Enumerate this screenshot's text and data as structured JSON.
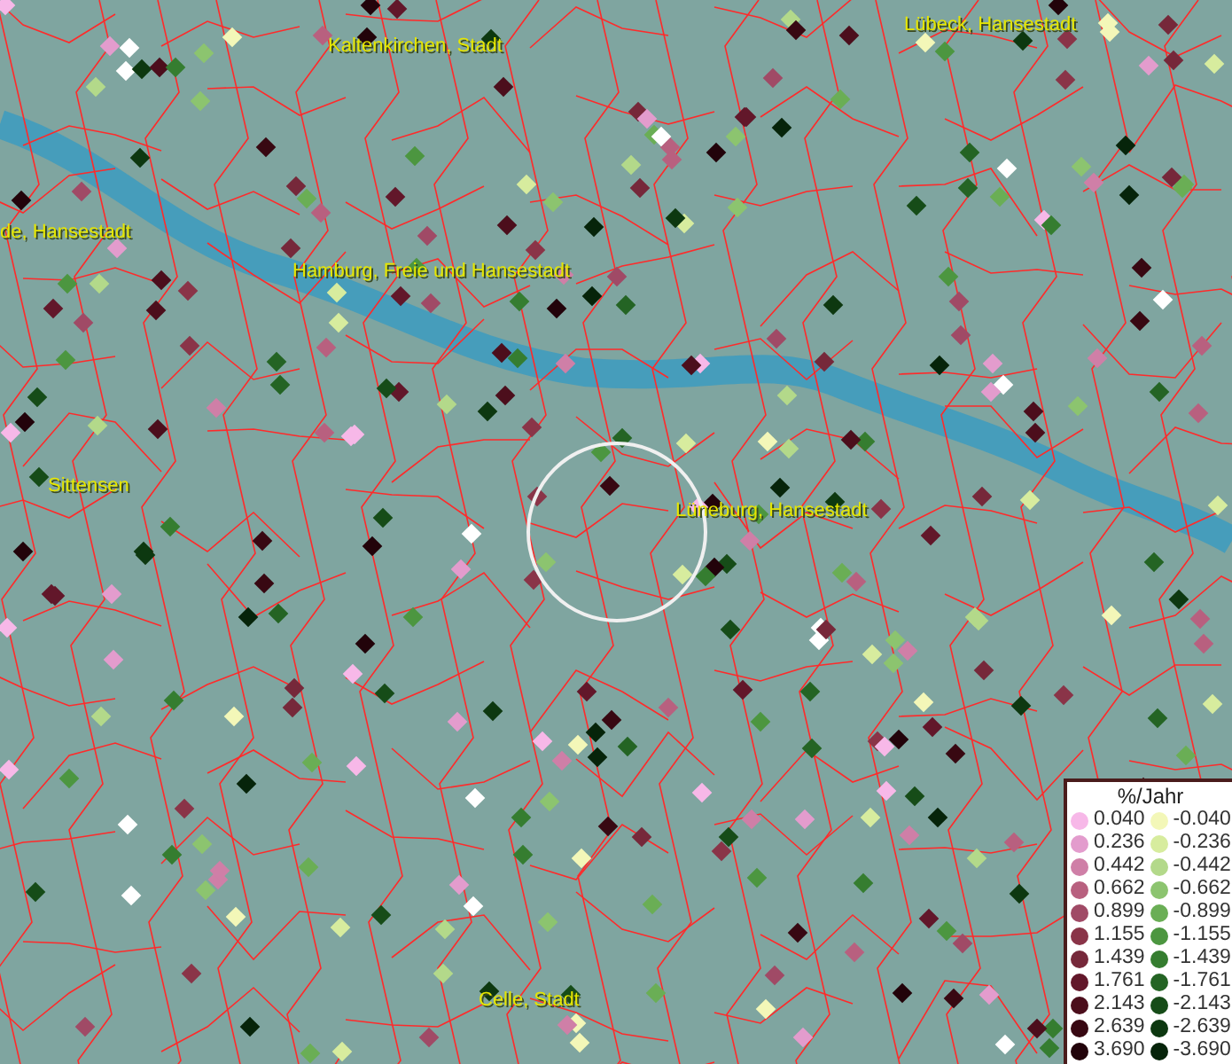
{
  "map": {
    "places": [
      {
        "name": "Kaltenkirchen, Stadt"
      },
      {
        "name": "Lübeck, Hansestadt"
      },
      {
        "name": "de, Hansestadt"
      },
      {
        "name": "Hamburg, Freie und Hansestadt"
      },
      {
        "name": "Sittensen"
      },
      {
        "name": "Lüneburg, Hansestadt"
      },
      {
        "name": "Celle, Stadt"
      }
    ]
  },
  "legend": {
    "title": "%/Jahr",
    "rows": [
      {
        "positive": {
          "value": "0.040",
          "color": "#f7b8e8"
        },
        "negative": {
          "value": "-0.040",
          "color": "#f3f7b8"
        }
      },
      {
        "positive": {
          "value": "0.236",
          "color": "#e39ccd"
        },
        "negative": {
          "value": "-0.236",
          "color": "#d7ec9e"
        }
      },
      {
        "positive": {
          "value": "0.442",
          "color": "#cf7fa7"
        },
        "negative": {
          "value": "-0.442",
          "color": "#b3d98a"
        }
      },
      {
        "positive": {
          "value": "0.662",
          "color": "#b8607f"
        },
        "negative": {
          "value": "-0.662",
          "color": "#8cc46f"
        }
      },
      {
        "positive": {
          "value": "0.899",
          "color": "#a04a66"
        },
        "negative": {
          "value": "-0.899",
          "color": "#6aae55"
        }
      },
      {
        "positive": {
          "value": "1.155",
          "color": "#8a3448"
        },
        "negative": {
          "value": "-1.155",
          "color": "#4c9640"
        }
      },
      {
        "positive": {
          "value": "1.439",
          "color": "#76283a"
        },
        "negative": {
          "value": "-1.439",
          "color": "#357d30"
        }
      },
      {
        "positive": {
          "value": "1.761",
          "color": "#62172a"
        },
        "negative": {
          "value": "-1.761",
          "color": "#246424"
        }
      },
      {
        "positive": {
          "value": "2.143",
          "color": "#4c0e1c"
        },
        "negative": {
          "value": "-2.143",
          "color": "#164c18"
        }
      },
      {
        "positive": {
          "value": "2.639",
          "color": "#380812"
        },
        "negative": {
          "value": "-2.639",
          "color": "#0d3810"
        }
      },
      {
        "positive": {
          "value": "3.690",
          "color": "#22030a"
        },
        "negative": {
          "value": "-3.690",
          "color": "#06240a"
        }
      }
    ]
  }
}
